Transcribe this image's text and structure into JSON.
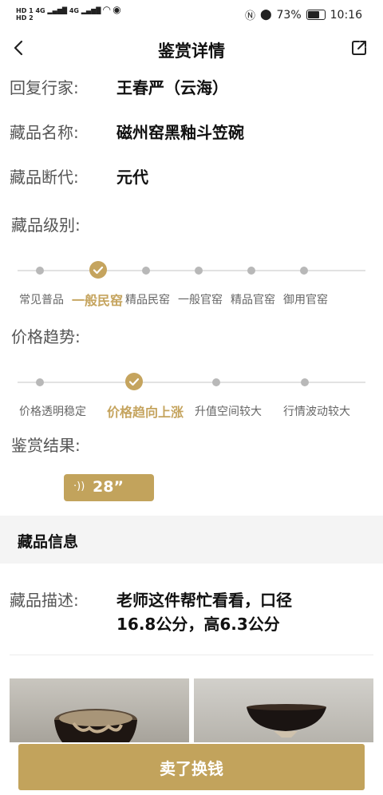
{
  "status": {
    "sim1": "HD 1",
    "sim2": "HD 2",
    "net": "4G",
    "battery": "73%",
    "time": "10:16"
  },
  "header": {
    "title": "鉴赏详情"
  },
  "details": [
    {
      "label": "回复行家:",
      "value": "王春严（云海）"
    },
    {
      "label": "藏品名称:",
      "value": "磁州窑黑釉斗笠碗"
    },
    {
      "label": "藏品断代:",
      "value": "元代"
    }
  ],
  "grade": {
    "label": "藏品级别:",
    "steps": [
      "常见普品",
      "一般民窑",
      "精品民窑",
      "一般官窑",
      "精品官窑",
      "御用官窑"
    ],
    "selected": 1
  },
  "trend": {
    "label": "价格趋势:",
    "steps": [
      "价格透明稳定",
      "价格趋向上涨",
      "升值空间较大",
      "行情波动较大"
    ],
    "selected": 1
  },
  "result": {
    "label": "鉴赏结果:",
    "voice_duration": "28”"
  },
  "info_section": {
    "title": "藏品信息",
    "desc_label": "藏品描述:",
    "desc_line1": "老师这件帮忙看看，口径",
    "desc_line2": "16.8公分，高6.3公分"
  },
  "sell_button": "卖了换钱",
  "colors": {
    "accent": "#c5a45e",
    "button": "#c2a35c",
    "section_bg": "#f4f4f4"
  }
}
